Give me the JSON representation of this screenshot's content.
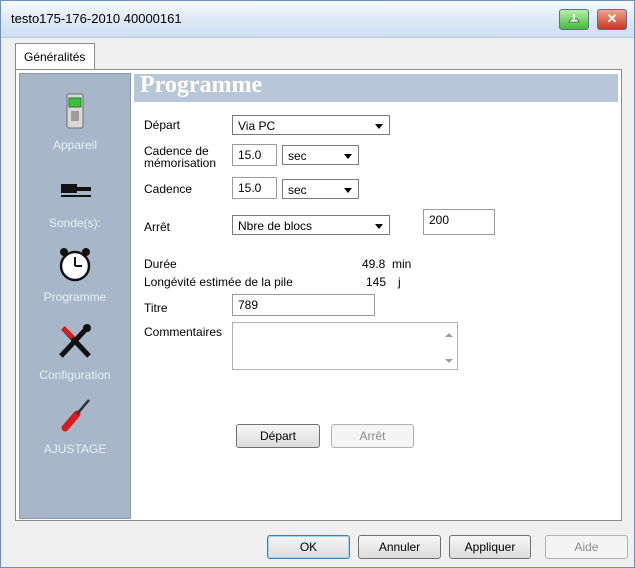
{
  "window": {
    "title": "testo175-176-2010 40000161"
  },
  "tab": {
    "label": "Généralités"
  },
  "sidebar": {
    "items": [
      {
        "label": "Appareil",
        "icon": "device-icon"
      },
      {
        "label": "Sonde(s):",
        "icon": "probe-icon"
      },
      {
        "label": "Programme",
        "icon": "alarm-clock-icon"
      },
      {
        "label": "Configuration",
        "icon": "tools-icon"
      },
      {
        "label": "AJUSTAGE",
        "icon": "screwdriver-icon"
      }
    ]
  },
  "section": {
    "title": "Programme"
  },
  "form": {
    "depart_label": "Départ",
    "depart_value": "Via PC",
    "cadence_mem_label": "Cadence de mémorisation",
    "cadence_mem_value": "15.0",
    "cadence_mem_unit": "sec",
    "cadence_label": "Cadence",
    "cadence_value": "15.0",
    "cadence_unit": "sec",
    "arret_label": "Arrêt",
    "arret_value": "Nbre de blocs",
    "arret_count": "200",
    "duree_label": "Durée",
    "duree_value": "49.8",
    "duree_unit": "min",
    "pile_label": "Longévité estimée de la pile",
    "pile_value": "145",
    "pile_unit": "j",
    "titre_label": "Titre",
    "titre_value": "789",
    "commentaires_label": "Commentaires",
    "commentaires_value": ""
  },
  "buttons": {
    "depart": "Départ",
    "arret": "Arrêt",
    "ok": "OK",
    "annuler": "Annuler",
    "appliquer": "Appliquer",
    "aide": "Aide"
  }
}
